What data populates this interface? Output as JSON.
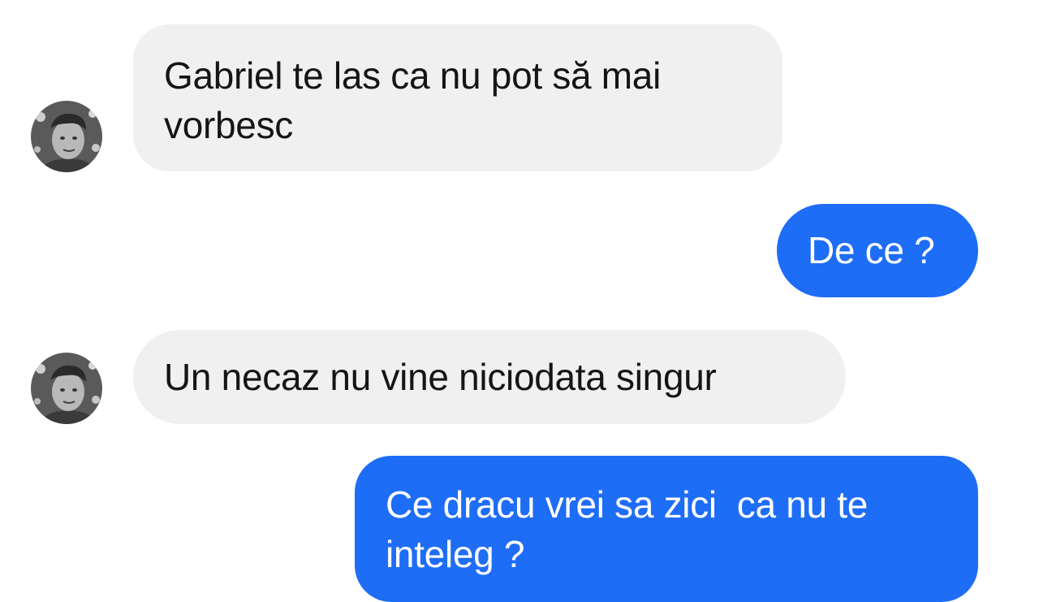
{
  "messages": [
    {
      "direction": "incoming",
      "text": "Gabriel te las ca nu pot să mai vorbesc",
      "avatar": "contact-avatar"
    },
    {
      "direction": "outgoing",
      "text": "De ce ?"
    },
    {
      "direction": "incoming",
      "text": "Un necaz nu vine niciodata singur",
      "avatar": "contact-avatar"
    },
    {
      "direction": "outgoing",
      "text": "Ce dracu vrei sa zici  ca nu te inteleg ?"
    }
  ],
  "colors": {
    "incoming_bubble": "#f0f0f0",
    "incoming_text": "#151515",
    "outgoing_bubble": "#1e6df6",
    "outgoing_text": "#ffffff"
  }
}
